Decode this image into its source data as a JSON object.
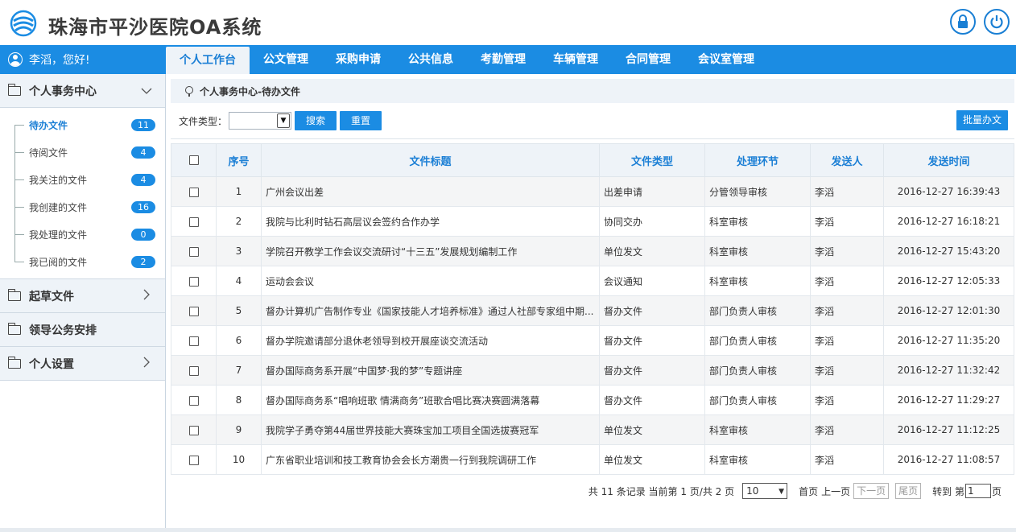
{
  "app": {
    "title": "珠海市平沙医院OA系统"
  },
  "user": {
    "greeting": "李滔，您好!"
  },
  "tabs": [
    {
      "label": "个人工作台",
      "active": true
    },
    {
      "label": "公文管理"
    },
    {
      "label": "采购申请"
    },
    {
      "label": "公共信息"
    },
    {
      "label": "考勤管理"
    },
    {
      "label": "车辆管理"
    },
    {
      "label": "合同管理"
    },
    {
      "label": "会议室管理"
    }
  ],
  "sidebar": {
    "groups": [
      {
        "label": "个人事务中心",
        "icon": "chevron-down-icon"
      },
      {
        "label": "起草文件",
        "icon": "chevron-right-icon"
      },
      {
        "label": "领导公务安排"
      },
      {
        "label": "个人设置",
        "icon": "chevron-right-icon"
      }
    ],
    "items": [
      {
        "label": "待办文件",
        "count": "11",
        "active": true
      },
      {
        "label": "待阅文件",
        "count": "4"
      },
      {
        "label": "我关注的文件",
        "count": "4"
      },
      {
        "label": "我创建的文件",
        "count": "16"
      },
      {
        "label": "我处理的文件",
        "count": "0"
      },
      {
        "label": "我已阅的文件",
        "count": "2"
      }
    ]
  },
  "breadcrumb": "个人事务中心-待办文件",
  "filter": {
    "label": "文件类型：",
    "search_label": "搜索",
    "reset_label": "重置",
    "batch_label": "批量办文"
  },
  "table": {
    "headers": [
      "序号",
      "文件标题",
      "文件类型",
      "处理环节",
      "发送人",
      "发送时间"
    ],
    "rows": [
      {
        "no": "1",
        "title": "广州会议出差",
        "type": "出差申请",
        "step": "分管领导审核",
        "sender": "李滔",
        "time": "2016-12-27 16:39:43"
      },
      {
        "no": "2",
        "title": "我院与比利时钻石高层议会签约合作办学",
        "type": "协同交办",
        "step": "科室审核",
        "sender": "李滔",
        "time": "2016-12-27 16:18:21"
      },
      {
        "no": "3",
        "title": "学院召开教学工作会议交流研讨“十三五”发展规划编制工作",
        "type": "单位发文",
        "step": "科室审核",
        "sender": "李滔",
        "time": "2016-12-27 15:43:20"
      },
      {
        "no": "4",
        "title": "运动会会议",
        "type": "会议通知",
        "step": "科室审核",
        "sender": "李滔",
        "time": "2016-12-27 12:05:33"
      },
      {
        "no": "5",
        "title": "督办计算机广告制作专业《国家技能人才培养标准》通过人社部专家组中期...",
        "type": "督办文件",
        "step": "部门负责人审核",
        "sender": "李滔",
        "time": "2016-12-27 12:01:30"
      },
      {
        "no": "6",
        "title": "督办学院邀请部分退休老领导到校开展座谈交流活动",
        "type": "督办文件",
        "step": "部门负责人审核",
        "sender": "李滔",
        "time": "2016-12-27 11:35:20"
      },
      {
        "no": "7",
        "title": "督办国际商务系开展“中国梦·我的梦”专题讲座",
        "type": "督办文件",
        "step": "部门负责人审核",
        "sender": "李滔",
        "time": "2016-12-27 11:32:42"
      },
      {
        "no": "8",
        "title": "督办国际商务系“唱响班歌 情满商务”班歌合唱比赛决赛圆满落幕",
        "type": "督办文件",
        "step": "部门负责人审核",
        "sender": "李滔",
        "time": "2016-12-27 11:29:27"
      },
      {
        "no": "9",
        "title": "我院学子勇夺第44届世界技能大赛珠宝加工项目全国选拔赛冠军",
        "type": "单位发文",
        "step": "科室审核",
        "sender": "李滔",
        "time": "2016-12-27 11:12:25"
      },
      {
        "no": "10",
        "title": "广东省职业培训和技工教育协会会长方潮贵一行到我院调研工作",
        "type": "单位发文",
        "step": "科室审核",
        "sender": "李滔",
        "time": "2016-12-27 11:08:57"
      }
    ]
  },
  "pager": {
    "summary": "共 11 条记录 当前第 1 页/共 2 页",
    "page_size": "10",
    "first": "首页",
    "prev": "上一页",
    "next": "下一页",
    "last": "尾页",
    "goto_prefix": "转到 第",
    "goto_value": "1",
    "goto_suffix": "页"
  },
  "colors": {
    "primary": "#1b8ce3",
    "header_bg": "#eef3f8",
    "link": "#1b7fd5"
  }
}
